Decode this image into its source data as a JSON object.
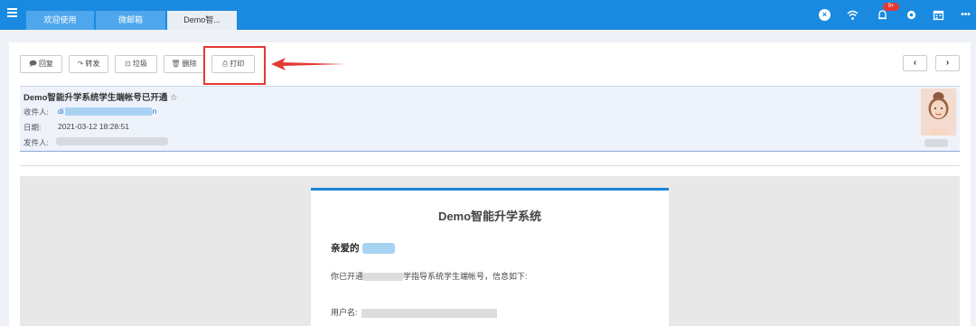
{
  "tabs": [
    {
      "label": "欢迎使用"
    },
    {
      "label": "微邮箱"
    },
    {
      "label": "Demo智..."
    }
  ],
  "topbar": {
    "notification_badge": "9+",
    "icons": [
      "close-circle-icon",
      "wifi-icon",
      "bell-icon",
      "gear-icon",
      "calendar-icon",
      "more-icon"
    ]
  },
  "toolbar": {
    "reply_label": "回复",
    "forward_label": "转发",
    "junk_label": "垃圾",
    "delete_label": "删除",
    "print_label": "打印",
    "prev_label": "‹",
    "next_label": "›"
  },
  "mail": {
    "subject": "Demo智能升学系统学生端帐号已开通",
    "star": "☆",
    "to_label": "收件人:",
    "to_value_visible": "di",
    "to_value_tail": "n",
    "date_label": "日期:",
    "date_value": "2021-03-12 18:28:51",
    "from_label": "发件人:"
  },
  "body": {
    "title": "Demo智能升学系统",
    "greeting": "亲爱的",
    "info_prefix": "你已开通",
    "info_suffix": "学指导系统学生端帐号，信息如下:",
    "username_label": "用户名:"
  },
  "colors": {
    "topbar": "#1a8ae0",
    "tab_inactive": "#4ea7ec",
    "tab_active": "#e9eef4",
    "highlight": "#e53935",
    "card_accent": "#1a86d8"
  }
}
